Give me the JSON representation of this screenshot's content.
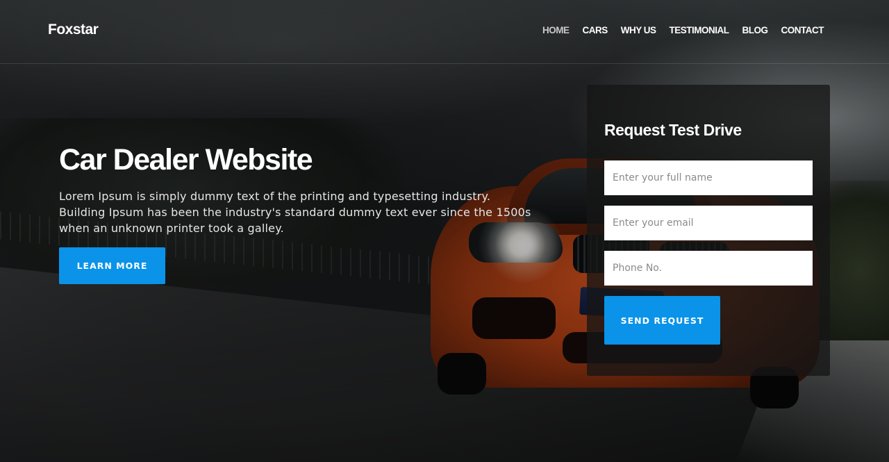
{
  "brand": {
    "logo": "Foxstar"
  },
  "nav": {
    "items": [
      {
        "label": "HOME",
        "active": true
      },
      {
        "label": "CARS",
        "active": false
      },
      {
        "label": "WHY US",
        "active": false
      },
      {
        "label": "TESTIMONIAL",
        "active": false
      },
      {
        "label": "BLOG",
        "active": false
      },
      {
        "label": "CONTACT",
        "active": false
      }
    ]
  },
  "hero": {
    "title": "Car Dealer Website",
    "description_lines": [
      "Lorem Ipsum is simply dummy text of the printing and typesetting industry.",
      "Building Ipsum has been the industry's standard dummy text ever since the 1500s",
      "when an unknown printer took a galley."
    ],
    "cta_label": "LEARN MORE"
  },
  "request_form": {
    "title": "Request Test Drive",
    "name_placeholder": "Enter your full name",
    "email_placeholder": "Enter your email",
    "phone_placeholder": "Phone No.",
    "submit_label": "SEND REQUEST"
  },
  "colors": {
    "accent": "#0a93e8",
    "text": "#ffffff",
    "panel": "#161616"
  }
}
